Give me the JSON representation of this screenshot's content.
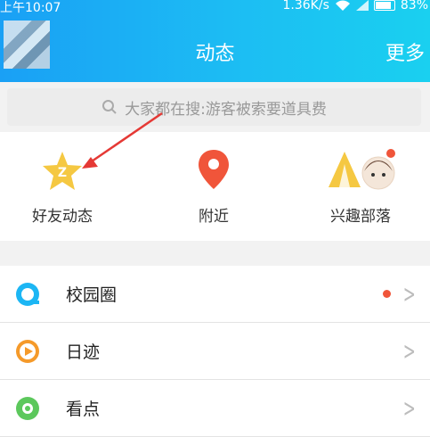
{
  "status_bar": {
    "time": "上午10:07",
    "speed": "1.36K/s",
    "battery": "83%"
  },
  "header": {
    "title": "动态",
    "more": "更多",
    "bg_color": "#1cb6f4"
  },
  "search": {
    "placeholder": "大家都在搜:游客被索要道具费"
  },
  "quick_items": [
    {
      "label": "好友动态",
      "icon": "star-icon"
    },
    {
      "label": "附近",
      "icon": "location-pin-icon"
    },
    {
      "label": "兴趣部落",
      "icon": "tent-icon"
    }
  ],
  "list": [
    {
      "label": "校园圈",
      "icon": "campus-icon",
      "has_dot": true
    },
    {
      "label": "日迹",
      "icon": "play-icon",
      "has_dot": false
    },
    {
      "label": "看点",
      "icon": "eye-icon",
      "has_dot": false
    }
  ],
  "accent_colors": {
    "red": "#f0553a",
    "yellow": "#f5c842",
    "orange": "#f59a2a"
  }
}
